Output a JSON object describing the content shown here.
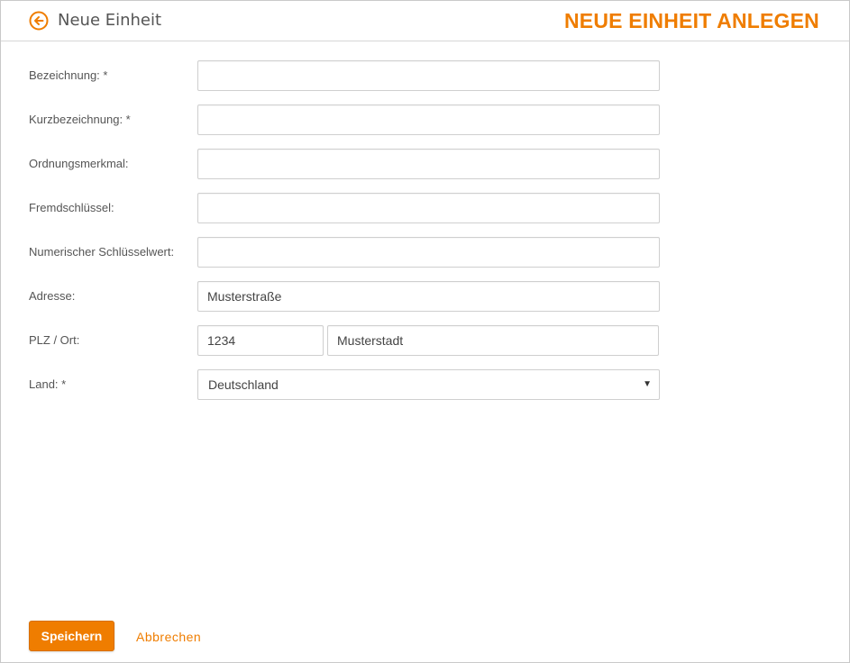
{
  "header": {
    "back_icon": "arrow-left-circle-icon",
    "title": "Neue Einheit",
    "page_heading": "NEUE EINHEIT ANLEGEN"
  },
  "colors": {
    "accent": "#ef7d00",
    "text": "#555555",
    "border": "#cfcfcf"
  },
  "form": {
    "bezeichnung": {
      "label": "Bezeichnung: *",
      "value": ""
    },
    "kurzbezeichnung": {
      "label": "Kurzbezeichnung: *",
      "value": ""
    },
    "ordnungsmerkmal": {
      "label": "Ordnungsmerkmal:",
      "value": ""
    },
    "fremdschluessel": {
      "label": "Fremdschlüssel:",
      "value": ""
    },
    "numerischer_schluesselwert": {
      "label": "Numerischer Schlüsselwert:",
      "value": ""
    },
    "adresse": {
      "label": "Adresse:",
      "value": "Musterstraße"
    },
    "plz_ort": {
      "label": "PLZ / Ort:",
      "plz_value": "1234",
      "ort_value": "Musterstadt"
    },
    "land": {
      "label": "Land: *",
      "selected": "Deutschland",
      "caret": "▼"
    }
  },
  "actions": {
    "save_label": "Speichern",
    "cancel_label": "Abbrechen"
  }
}
